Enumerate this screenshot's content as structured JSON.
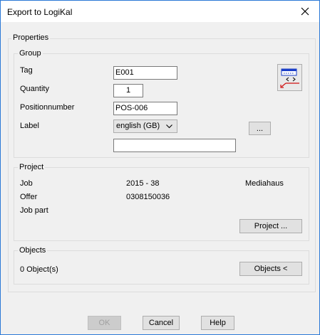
{
  "window": {
    "title": "Export to LogiKal"
  },
  "properties": {
    "label": "Properties",
    "group": {
      "label": "Group",
      "tag_label": "Tag",
      "tag_value": "E001",
      "quantity_label": "Quantity",
      "quantity_value": "1",
      "position_label": "Positionnumber",
      "position_value": "POS-006",
      "label_label": "Label",
      "language_selected": "english (GB)",
      "browse_label": "...",
      "label_value": ""
    },
    "project": {
      "label": "Project",
      "job_label": "Job",
      "job_value": "2015 - 38",
      "job_name": "Mediahaus",
      "offer_label": "Offer",
      "offer_value": "0308150036",
      "jobpart_label": "Job part",
      "project_button": "Project ..."
    },
    "objects": {
      "label": "Objects",
      "count_text": "0 Object(s)",
      "objects_button": "Objects <"
    }
  },
  "buttons": {
    "ok": "OK",
    "cancel": "Cancel",
    "help": "Help"
  },
  "icons": {
    "close": "close-icon",
    "export": "export-logikal-icon",
    "dropdown": "chevron-down-icon"
  }
}
